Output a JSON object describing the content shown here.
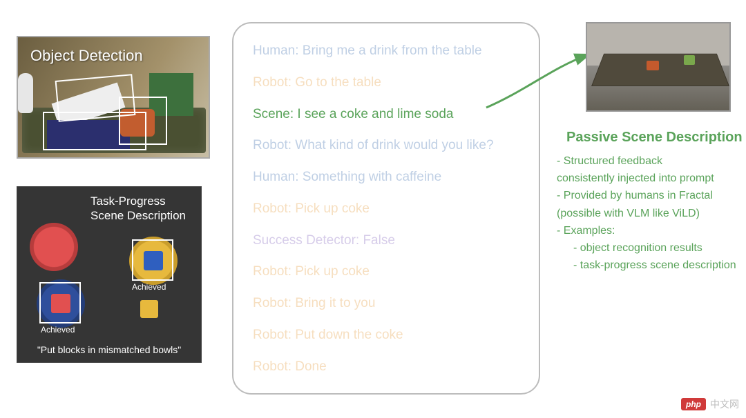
{
  "object_detection": {
    "title": "Object Detection"
  },
  "task_progress": {
    "title_line1": "Task-Progress",
    "title_line2": "Scene Description",
    "achieved_label": "Achieved",
    "instruction": "\"Put blocks in mismatched bowls\""
  },
  "dialog": {
    "lines": [
      {
        "text": "Human: Bring me a drink from the table",
        "cls": "c-blue dim"
      },
      {
        "text": "Robot: Go to the table",
        "cls": "c-orange dim"
      },
      {
        "text": "Scene: I see a coke and lime soda",
        "cls": "c-green"
      },
      {
        "text": "Robot: What kind of drink would you like?",
        "cls": "c-blue dim"
      },
      {
        "text": "Human: Something with caffeine",
        "cls": "c-blue dim"
      },
      {
        "text": "Robot: Pick up coke",
        "cls": "c-orange dim"
      },
      {
        "text": "Success Detector: False",
        "cls": "c-purple dim"
      },
      {
        "text": "Robot: Pick up coke",
        "cls": "c-orange dim"
      },
      {
        "text": "Robot: Bring it to you",
        "cls": "c-orange dim"
      },
      {
        "text": "Robot: Put down the coke",
        "cls": "c-orange dim"
      },
      {
        "text": "Robot: Done",
        "cls": "c-orange dim"
      }
    ]
  },
  "passive_scene": {
    "heading": "Passive Scene Description",
    "bullets": [
      "- Structured feedback",
      "  consistently injected into prompt",
      "- Provided by humans in Fractal",
      "  (possible with VLM like ViLD)",
      "- Examples:",
      "    - object recognition results",
      "    - task-progress scene description"
    ]
  },
  "watermark": {
    "badge": "php",
    "text": "中文网"
  }
}
